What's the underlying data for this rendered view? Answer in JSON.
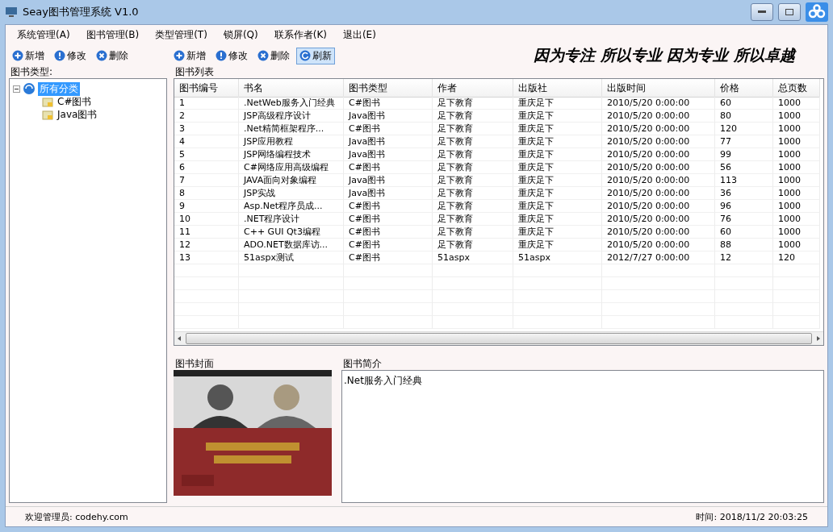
{
  "window": {
    "title": "Seay图书管理系统  V1.0"
  },
  "menu": [
    "系统管理(A)",
    "图书管理(B)",
    "类型管理(T)",
    "锁屏(Q)",
    "联系作者(K)",
    "退出(E)"
  ],
  "left_toolbar": [
    {
      "kind": "add",
      "label": "新增",
      "highlighted": false
    },
    {
      "kind": "edit",
      "label": "修改",
      "highlighted": false
    },
    {
      "kind": "delete",
      "label": "删除",
      "highlighted": false
    }
  ],
  "right_toolbar": [
    {
      "kind": "add",
      "label": "新增",
      "highlighted": false
    },
    {
      "kind": "edit",
      "label": "修改",
      "highlighted": false
    },
    {
      "kind": "delete",
      "label": "删除",
      "highlighted": false
    },
    {
      "kind": "refresh",
      "label": "刷新",
      "highlighted": true
    }
  ],
  "slogan": "因为专注 所以专业 因为专业 所以卓越",
  "category_panel": {
    "title": "图书类型:",
    "tree": [
      {
        "label": "所有分类",
        "selected": true,
        "expanded": true,
        "children": [
          {
            "label": "C#图书",
            "selected": false
          },
          {
            "label": "Java图书",
            "selected": false
          }
        ]
      }
    ]
  },
  "book_list": {
    "title": "图书列表",
    "columns": [
      "图书编号",
      "书名",
      "图书类型",
      "作者",
      "出版社",
      "出版时间",
      "价格",
      "总页数"
    ],
    "rows": [
      [
        "1",
        ".NetWeb服务入门经典",
        "C#图书",
        "足下教育",
        "重庆足下",
        "2010/5/20 0:00:00",
        "60",
        "1000"
      ],
      [
        "2",
        "JSP高级程序设计",
        "Java图书",
        "足下教育",
        "重庆足下",
        "2010/5/20 0:00:00",
        "80",
        "1000"
      ],
      [
        "3",
        ".Net精简框架程序...",
        "C#图书",
        "足下教育",
        "重庆足下",
        "2010/5/20 0:00:00",
        "120",
        "1000"
      ],
      [
        "4",
        "JSP应用教程",
        "Java图书",
        "足下教育",
        "重庆足下",
        "2010/5/20 0:00:00",
        "77",
        "1000"
      ],
      [
        "5",
        "JSP网络编程技术",
        "Java图书",
        "足下教育",
        "重庆足下",
        "2010/5/20 0:00:00",
        "99",
        "1000"
      ],
      [
        "6",
        "C#网络应用高级编程",
        "C#图书",
        "足下教育",
        "重庆足下",
        "2010/5/20 0:00:00",
        "56",
        "1000"
      ],
      [
        "7",
        "JAVA面向对象编程",
        "Java图书",
        "足下教育",
        "重庆足下",
        "2010/5/20 0:00:00",
        "113",
        "1000"
      ],
      [
        "8",
        "JSP实战",
        "Java图书",
        "足下教育",
        "重庆足下",
        "2010/5/20 0:00:00",
        "36",
        "1000"
      ],
      [
        "9",
        "Asp.Net程序员成...",
        "C#图书",
        "足下教育",
        "重庆足下",
        "2010/5/20 0:00:00",
        "96",
        "1000"
      ],
      [
        "10",
        ".NET程序设计",
        "C#图书",
        "足下教育",
        "重庆足下",
        "2010/5/20 0:00:00",
        "76",
        "1000"
      ],
      [
        "11",
        "C++ GUI Qt3编程",
        "C#图书",
        "足下教育",
        "重庆足下",
        "2010/5/20 0:00:00",
        "60",
        "1000"
      ],
      [
        "12",
        "ADO.NET数据库访...",
        "C#图书",
        "足下教育",
        "重庆足下",
        "2010/5/20 0:00:00",
        "88",
        "1000"
      ],
      [
        "13",
        "51aspx测试",
        "C#图书",
        "51aspx",
        "51aspx",
        "2012/7/27 0:00:00",
        "12",
        "120"
      ]
    ]
  },
  "cover": {
    "title": "图书封面",
    "kind": "picture"
  },
  "summary": {
    "title": "图书简介",
    "text": ".Net服务入门经典"
  },
  "status_bar": {
    "welcome": "欢迎管理员: codehy.com",
    "time": "时间: 2018/11/2 20:03:25"
  }
}
